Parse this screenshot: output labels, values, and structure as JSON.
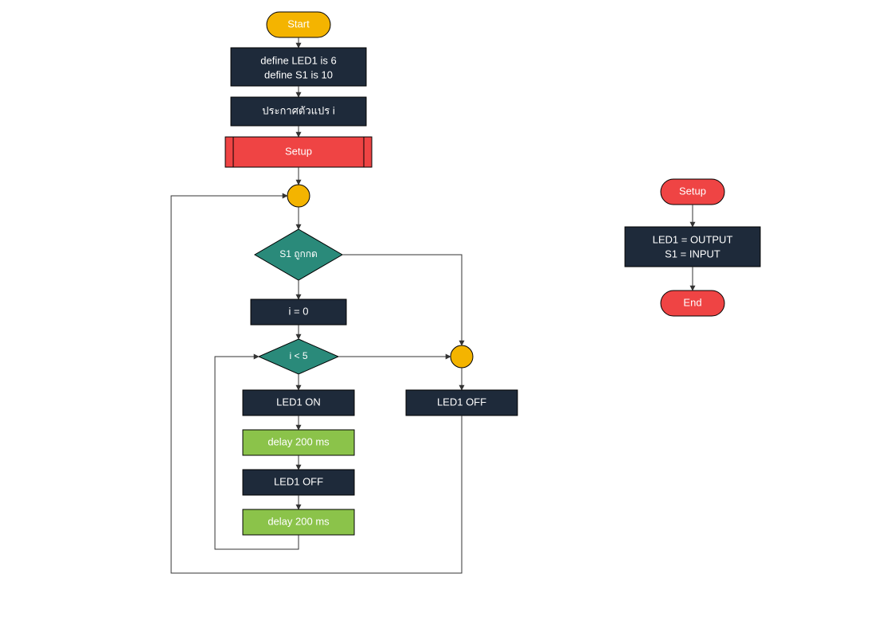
{
  "main": {
    "start": "Start",
    "define_l1": "define LED1 is 6",
    "define_l2": "define S1 is 10",
    "declare_i": "ประกาศตัวแปร i",
    "setup_call": "Setup",
    "dec_s1": "S1 ถูกกด",
    "i_zero": "i = 0",
    "dec_i5": "i < 5",
    "led_on": "LED1 ON",
    "delay1": "delay 200 ms",
    "led_off_inner": "LED1 OFF",
    "delay2": "delay 200 ms",
    "led_off_outer": "LED1 OFF"
  },
  "sub": {
    "setup": "Setup",
    "body_l1": "LED1 = OUTPUT",
    "body_l2": "S1 = INPUT",
    "end": "End"
  },
  "colors": {
    "navy": "#1e2a3a",
    "red": "#ef4444",
    "green": "#8bc34a",
    "teal": "#2a8a7a",
    "gold": "#f4b400"
  }
}
